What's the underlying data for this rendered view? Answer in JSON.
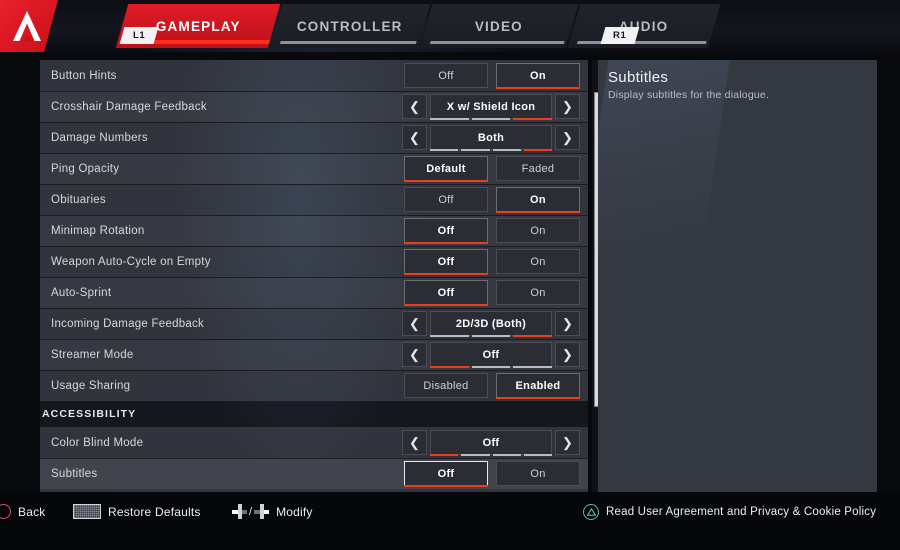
{
  "header": {
    "logo_name": "apex-legends-logo",
    "bumper_left": "L1",
    "bumper_right": "R1",
    "tabs": [
      {
        "label": "GAMEPLAY",
        "active": true
      },
      {
        "label": "CONTROLLER",
        "active": false
      },
      {
        "label": "VIDEO",
        "active": false
      },
      {
        "label": "AUDIO",
        "active": false
      }
    ]
  },
  "settings": {
    "rows": [
      {
        "label": "Button Hints",
        "type": "toggle",
        "options": [
          "Off",
          "On"
        ],
        "selected": "On"
      },
      {
        "label": "Crosshair Damage Feedback",
        "type": "selector",
        "value": "X w/ Shield Icon",
        "segments": 3,
        "active_segment": 3
      },
      {
        "label": "Damage Numbers",
        "type": "selector",
        "value": "Both",
        "segments": 4,
        "active_segment": 4
      },
      {
        "label": "Ping Opacity",
        "type": "toggle",
        "options": [
          "Default",
          "Faded"
        ],
        "selected": "Default"
      },
      {
        "label": "Obituaries",
        "type": "toggle",
        "options": [
          "Off",
          "On"
        ],
        "selected": "On"
      },
      {
        "label": "Minimap Rotation",
        "type": "toggle",
        "options": [
          "Off",
          "On"
        ],
        "selected": "Off"
      },
      {
        "label": "Weapon Auto-Cycle on Empty",
        "type": "toggle",
        "options": [
          "Off",
          "On"
        ],
        "selected": "Off"
      },
      {
        "label": "Auto-Sprint",
        "type": "toggle",
        "options": [
          "Off",
          "On"
        ],
        "selected": "Off"
      },
      {
        "label": "Incoming Damage Feedback",
        "type": "selector",
        "value": "2D/3D (Both)",
        "segments": 3,
        "active_segment": 3
      },
      {
        "label": "Streamer Mode",
        "type": "selector",
        "value": "Off",
        "segments": 3,
        "active_segment": 1
      },
      {
        "label": "Usage Sharing",
        "type": "toggle",
        "options": [
          "Disabled",
          "Enabled"
        ],
        "selected": "Enabled"
      }
    ],
    "section_header": "ACCESSIBILITY",
    "accessibility_rows": [
      {
        "label": "Color Blind Mode",
        "type": "selector",
        "value": "Off",
        "segments": 4,
        "active_segment": 1
      },
      {
        "label": "Subtitles",
        "type": "toggle",
        "options": [
          "Off",
          "On"
        ],
        "selected": "Off",
        "highlighted": true
      }
    ]
  },
  "info": {
    "title": "Subtitles",
    "description": "Display subtitles for the dialogue."
  },
  "footer": {
    "back_label": "Back",
    "restore_label": "Restore Defaults",
    "modify_label": "Modify",
    "modify_separator": "/",
    "policy_label": "Read User Agreement and Privacy & Cookie Policy"
  },
  "colors": {
    "accent_red": "#e8401c",
    "brand_red": "#e01b26",
    "panel_bg": "#31343c",
    "info_bg": "#343841",
    "policy_green": "#5fbf8e"
  }
}
